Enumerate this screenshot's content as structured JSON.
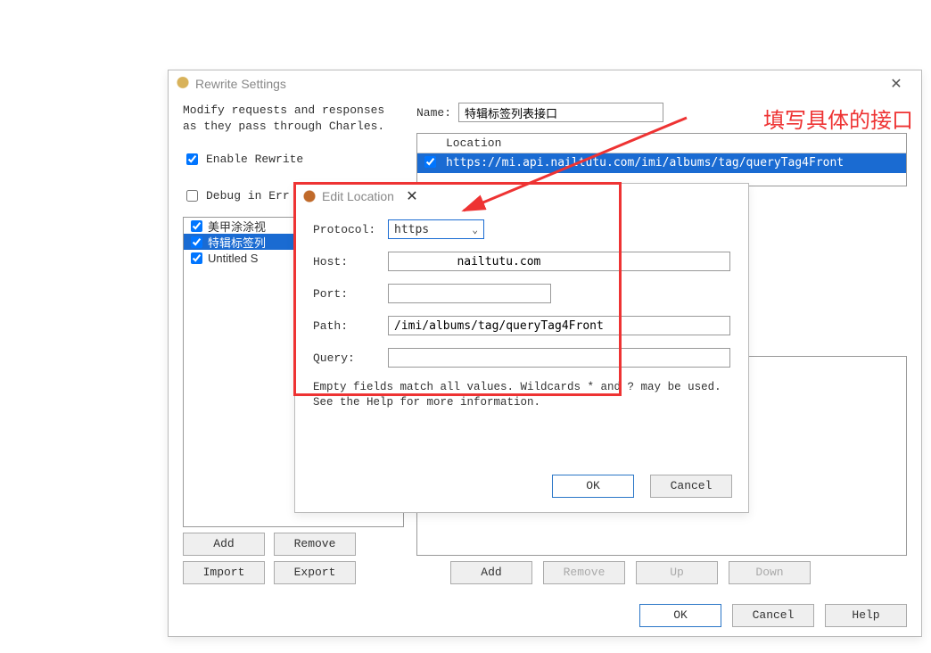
{
  "annotation": {
    "text": "填写具体的接口"
  },
  "rewrite_settings": {
    "title": "Rewrite Settings",
    "description_line1": "Modify requests and responses",
    "description_line2": "as they pass through Charles.",
    "enable_rewrite_label": "Enable Rewrite",
    "debug_label": "Debug in Err",
    "rules": [
      {
        "label": "美甲涂涂视",
        "checked": true,
        "selected": false
      },
      {
        "label": "特辑标签列",
        "checked": true,
        "selected": true
      },
      {
        "label": "Untitled S",
        "checked": true,
        "selected": false
      }
    ],
    "buttons": {
      "add": "Add",
      "remove": "Remove",
      "import": "Import",
      "export": "Export"
    },
    "name_label": "Name:",
    "name_value": "特辑标签列表接口",
    "location_header": "Location",
    "location_entry": "https://mi.api.nailtutu.com/imi/albums/tag/queryTag4Front",
    "rule_buttons": {
      "add": "Add",
      "remove": "Remove",
      "up": "Up",
      "down": "Down"
    },
    "dialog_buttons": {
      "ok": "OK",
      "cancel": "Cancel",
      "help": "Help"
    }
  },
  "edit_location": {
    "title": "Edit Location",
    "fields": {
      "protocol_label": "Protocol:",
      "protocol_value": "https",
      "host_label": "Host:",
      "host_value": "         nailtutu.com",
      "port_label": "Port:",
      "port_value": "",
      "path_label": "Path:",
      "path_value": "/imi/albums/tag/queryTag4Front",
      "query_label": "Query:",
      "query_value": ""
    },
    "help_text": "Empty fields match all values. Wildcards * and ? may be used. See the Help for more information.",
    "buttons": {
      "ok": "OK",
      "cancel": "Cancel"
    }
  }
}
